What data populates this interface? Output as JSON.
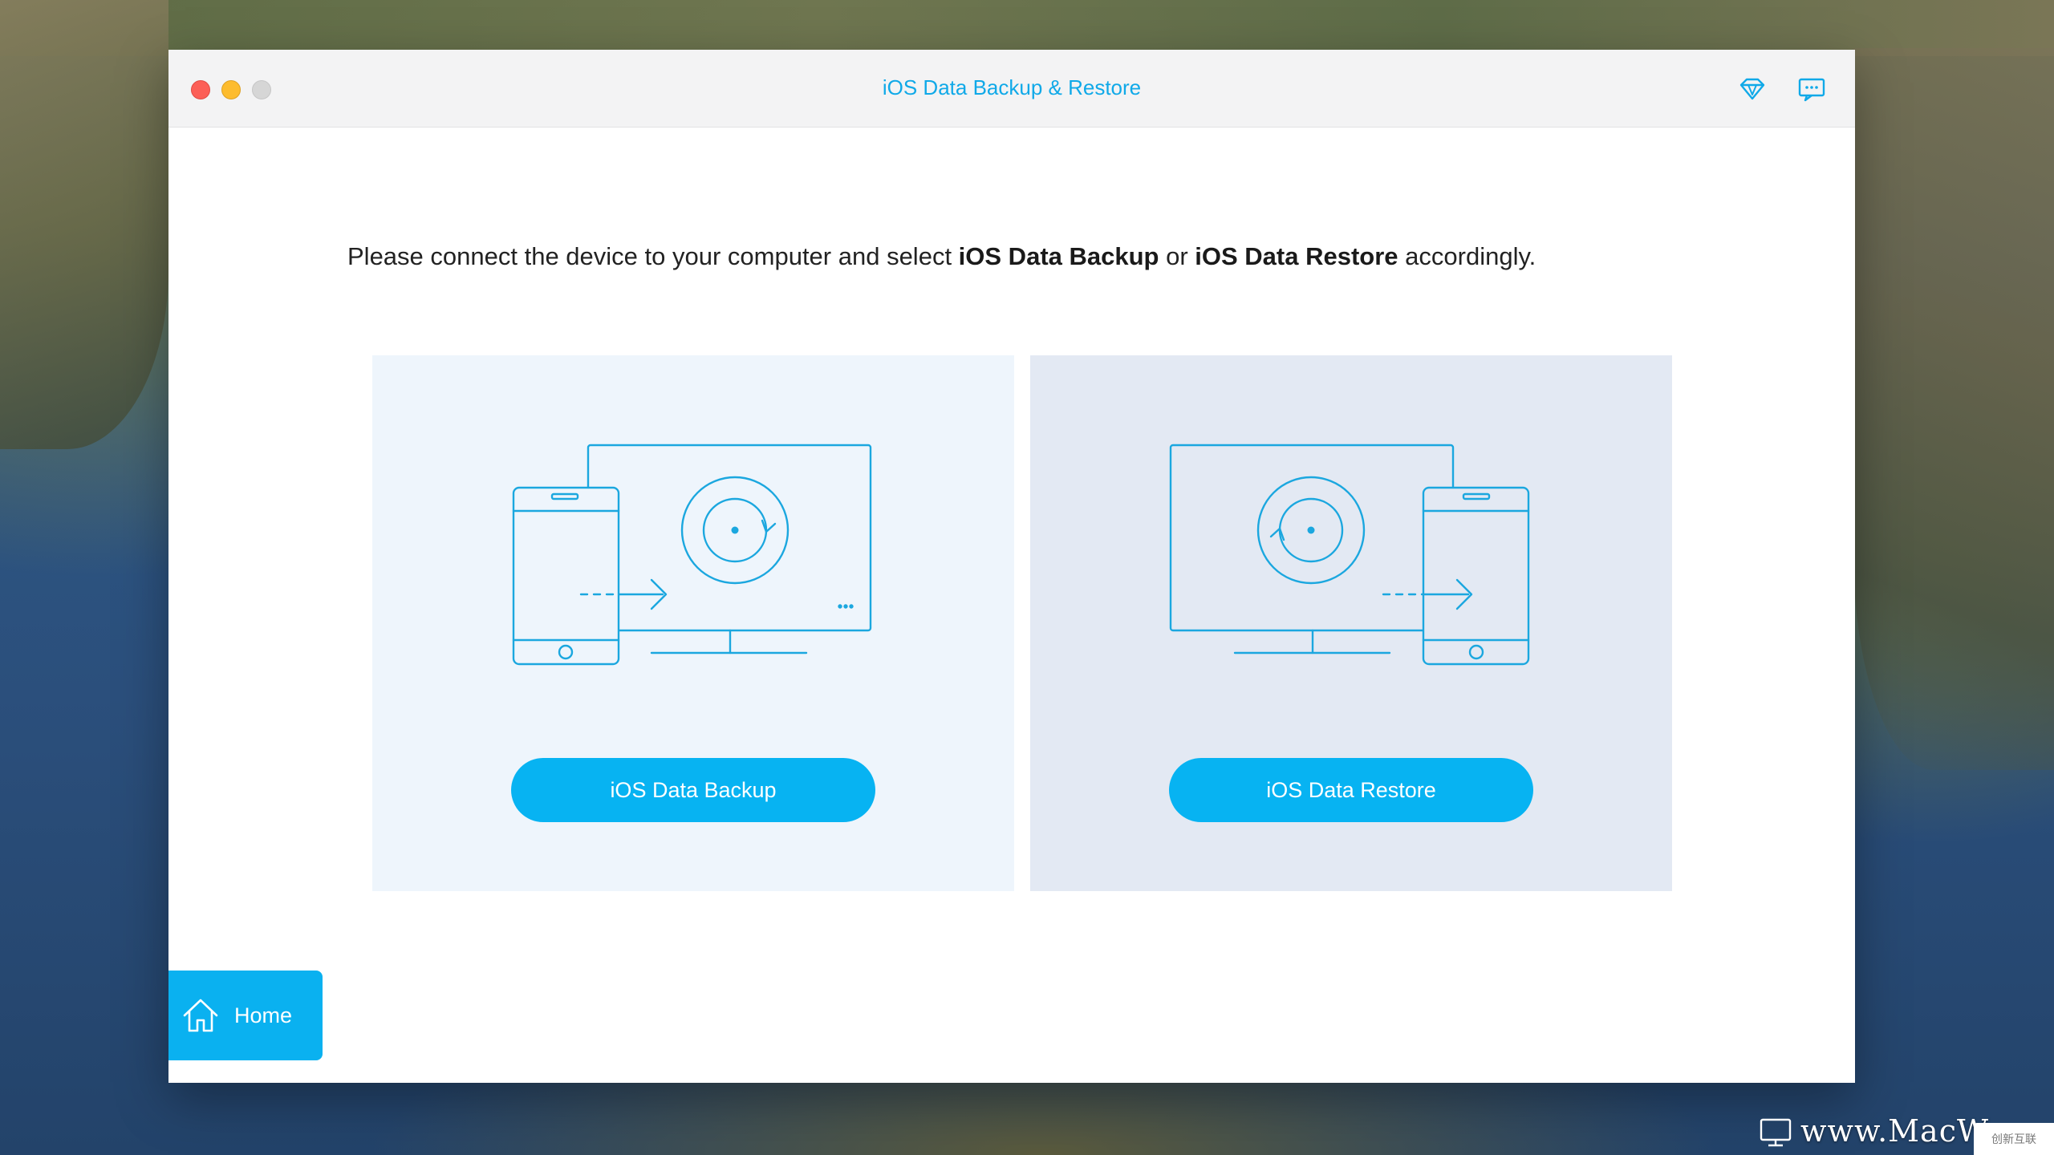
{
  "window": {
    "title": "iOS Data Backup & Restore",
    "icons": {
      "diamond": "diamond-icon",
      "feedback": "chat-icon"
    }
  },
  "instruction": {
    "pre": "Please connect the device to your computer and select ",
    "bold1": "iOS Data Backup",
    "mid": " or ",
    "bold2": "iOS Data Restore",
    "post": " accordingly."
  },
  "cards": {
    "backup": {
      "button_label": "iOS Data Backup"
    },
    "restore": {
      "button_label": "iOS Data Restore"
    }
  },
  "sidebar": {
    "home_label": "Home"
  },
  "watermark": {
    "text": "www.MacW",
    "badge": "创新互联"
  },
  "colors": {
    "accent": "#07b3f2",
    "title": "#10a9e8",
    "card_backup_bg": "#eef5fc",
    "card_restore_bg": "#e3e9f3"
  }
}
